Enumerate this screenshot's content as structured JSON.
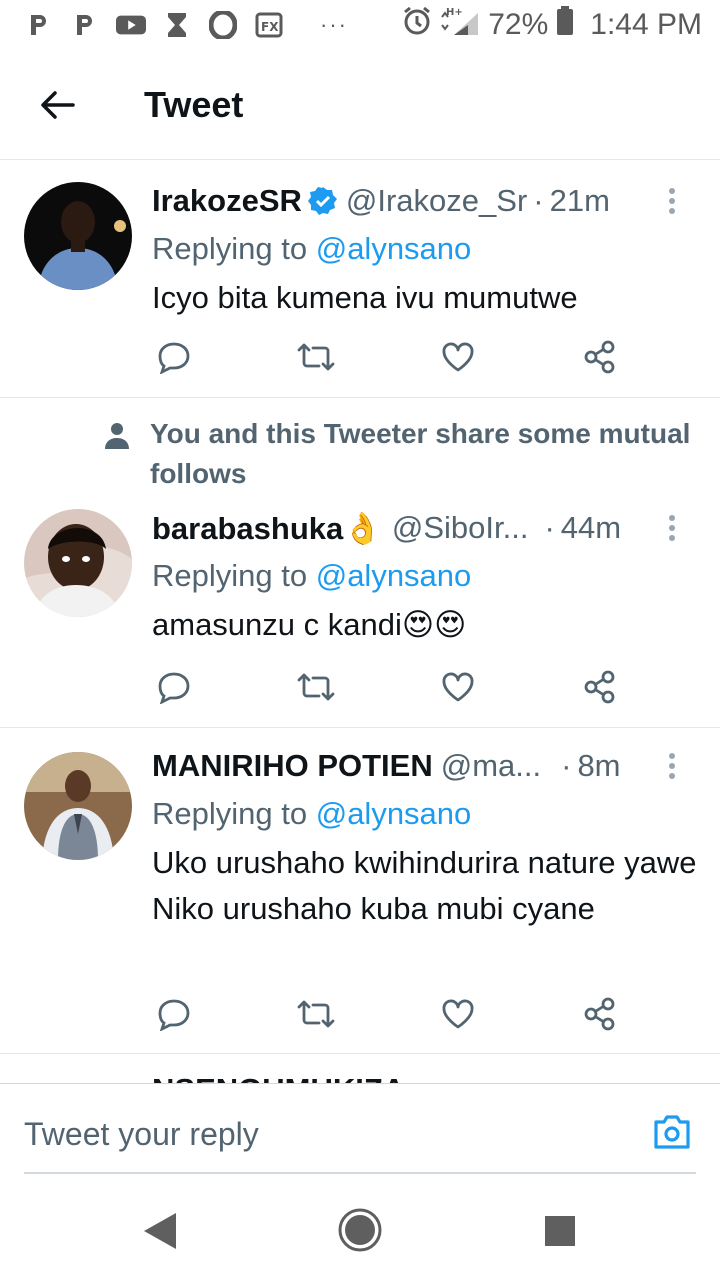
{
  "statusbar": {
    "battery_pct": "72%",
    "time": "1:44 PM",
    "dots": "···",
    "network": "H+"
  },
  "header": {
    "title": "Tweet"
  },
  "tweets": [
    {
      "name": "IrakozeSR",
      "verified": true,
      "handle": "@Irakoze_Sr",
      "sep": "·",
      "time": "21m",
      "replying_prefix": "Replying to ",
      "replying_to": "@alynsano",
      "text": "Icyo bita kumena ivu mumutwe"
    },
    {
      "social_context": "You and this Tweeter share some mutual follows",
      "name": "barabashuka👌",
      "handle": "@SiboIr...",
      "sep": "·",
      "time": "44m",
      "replying_prefix": "Replying to ",
      "replying_to": "@alynsano",
      "text": "amasunzu c kandi😍😍"
    },
    {
      "name": "MANIRIHO POTIEN",
      "handle": "@ma...",
      "sep": "·",
      "time": "8m",
      "replying_prefix": "Replying to ",
      "replying_to": "@alynsano",
      "text": "Uko urushaho kwihindurira nature yawe Niko urushaho kuba mubi cyane"
    },
    {
      "name": "NSENGUMUKIZA",
      "partial": true
    }
  ],
  "reply_bar": {
    "placeholder": "Tweet your reply"
  },
  "colors": {
    "accent": "#1d9bf0",
    "text": "#0f1419",
    "secondary": "#536471"
  }
}
